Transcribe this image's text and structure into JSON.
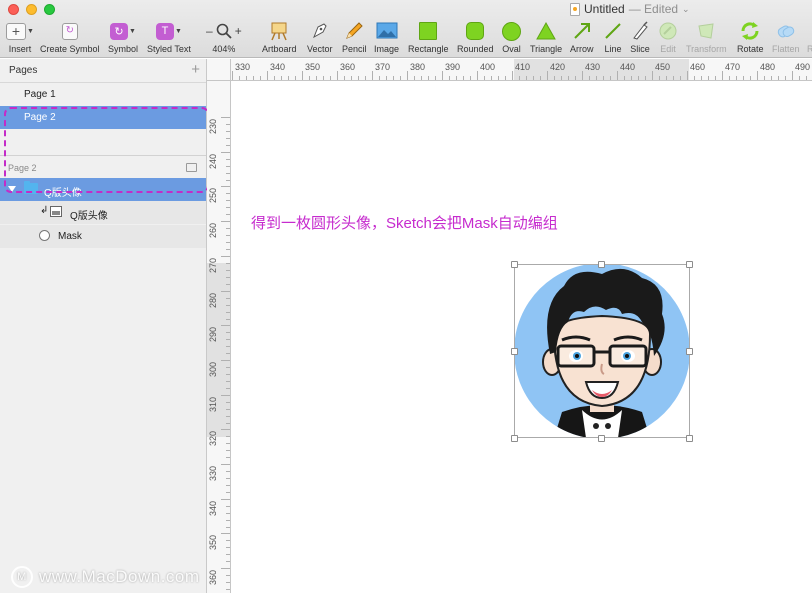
{
  "window": {
    "title": "Untitled",
    "status": "— Edited",
    "status_chevron": "⌄"
  },
  "toolbar": {
    "insert": "Insert",
    "create_symbol": "Create Symbol",
    "symbol": "Symbol",
    "styled_text": "Styled Text",
    "zoom_minus": "–",
    "zoom_plus": "+",
    "zoom_level": "404%",
    "artboard": "Artboard",
    "vector": "Vector",
    "pencil": "Pencil",
    "image": "Image",
    "rectangle": "Rectangle",
    "rounded": "Rounded",
    "oval": "Oval",
    "triangle": "Triangle",
    "arrow": "Arrow",
    "line": "Line",
    "slice": "Slice",
    "edit": "Edit",
    "transform": "Transform",
    "rotate": "Rotate",
    "flatten": "Flatten",
    "truncated": "R"
  },
  "sidebar": {
    "pages_title": "Pages",
    "add_page": "+",
    "pages": [
      {
        "label": "Page 1",
        "selected": false
      },
      {
        "label": "Page 2",
        "selected": true
      }
    ],
    "layers_title": "Page 2",
    "layers": [
      {
        "label": "Q版头像",
        "type": "group",
        "selected": true
      },
      {
        "label": "Q版头像",
        "type": "bitmap",
        "masked": true
      },
      {
        "label": "Mask",
        "type": "oval"
      }
    ]
  },
  "ruler_h": {
    "labels": [
      "330",
      "340",
      "350",
      "360",
      "370",
      "380",
      "390",
      "400",
      "410",
      "420",
      "430",
      "440",
      "450",
      "460",
      "470",
      "480",
      "490"
    ]
  },
  "ruler_v": {
    "labels": [
      "230",
      "240",
      "250",
      "260",
      "270",
      "280",
      "290",
      "300",
      "310",
      "320",
      "330",
      "340",
      "350",
      "360"
    ]
  },
  "canvas": {
    "annotation": "得到一枚圆形头像，Sketch会把Mask自动编组",
    "mask_color": "#8fc4f4"
  },
  "watermark": {
    "text": "www.MacDown.com",
    "logo": "M"
  },
  "colors": {
    "selection": "#6b9be1",
    "annotation": "#c62bce",
    "tool_green": "#7ed321",
    "tool_purple": "#c35ed2"
  }
}
